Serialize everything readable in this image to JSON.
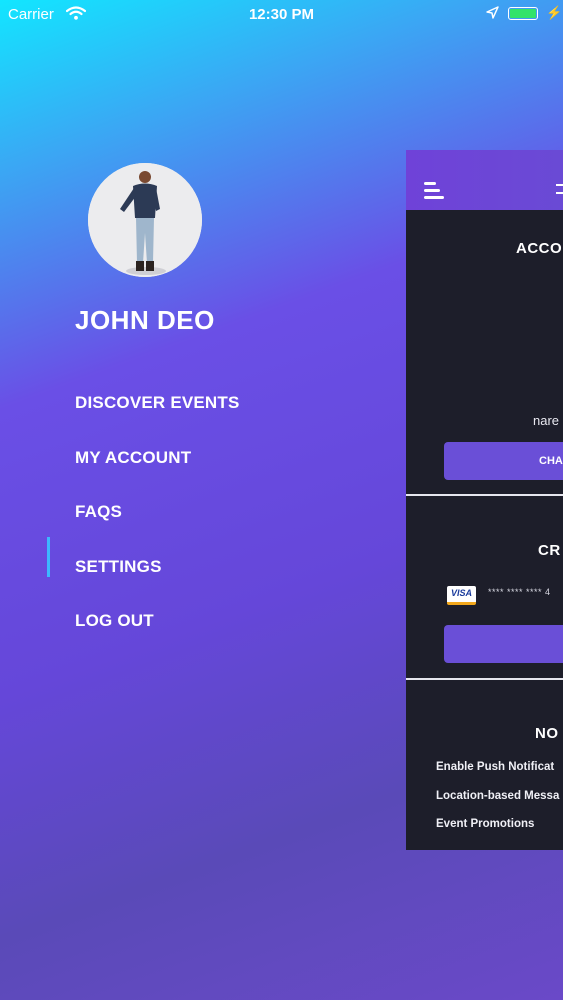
{
  "status_bar": {
    "carrier": "Carrier",
    "wifi_icon": "wifi-icon",
    "time": "12:30 PM",
    "location_icon": "location-arrow-icon",
    "battery_level": 1.0,
    "battery_color": "#33e36a"
  },
  "sidebar": {
    "user_name": "JOHN DEO",
    "items": [
      {
        "label": "DISCOVER EVENTS"
      },
      {
        "label": "MY ACCOUNT"
      },
      {
        "label": "FAQS"
      },
      {
        "label": "SETTINGS",
        "active": true
      },
      {
        "label": "LOG OUT"
      }
    ],
    "active_indicator_color": "#3db7ff"
  },
  "panel": {
    "account_title": "ACCO",
    "email_fragment": "nare",
    "change_button_label": "CHA",
    "cards_title": "CR",
    "card_brand": "VISA",
    "card_number": "**** **** **** 4",
    "notifications_title": "NO",
    "notifications": [
      {
        "label": "Enable Push Notificat"
      },
      {
        "label": "Location-based Messa"
      },
      {
        "label": "Event Promotions"
      }
    ]
  }
}
